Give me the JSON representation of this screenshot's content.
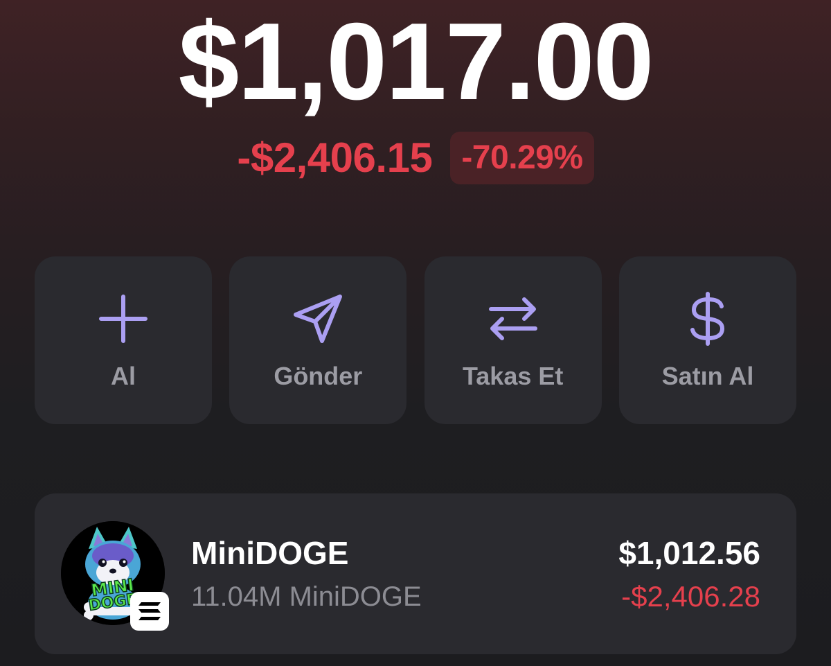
{
  "balance": {
    "total": "$1,017.00",
    "change_amount": "-$2,406.15",
    "change_percent": "-70.29%"
  },
  "actions": [
    {
      "label": "Al",
      "icon": "plus-icon"
    },
    {
      "label": "Gönder",
      "icon": "send-icon"
    },
    {
      "label": "Takas Et",
      "icon": "swap-icon"
    },
    {
      "label": "Satın Al",
      "icon": "dollar-icon"
    }
  ],
  "tokens": [
    {
      "name": "MiniDOGE",
      "amount": "11.04M MiniDOGE",
      "value": "$1,012.56",
      "change": "-$2,406.28",
      "logo_text": "MINI DOGE",
      "chain_icon": "solana-icon"
    }
  ],
  "colors": {
    "accent": "#ab9ff2",
    "negative": "#e5404d",
    "card": "#2a2a2f",
    "muted_text": "#9c9ca4"
  }
}
